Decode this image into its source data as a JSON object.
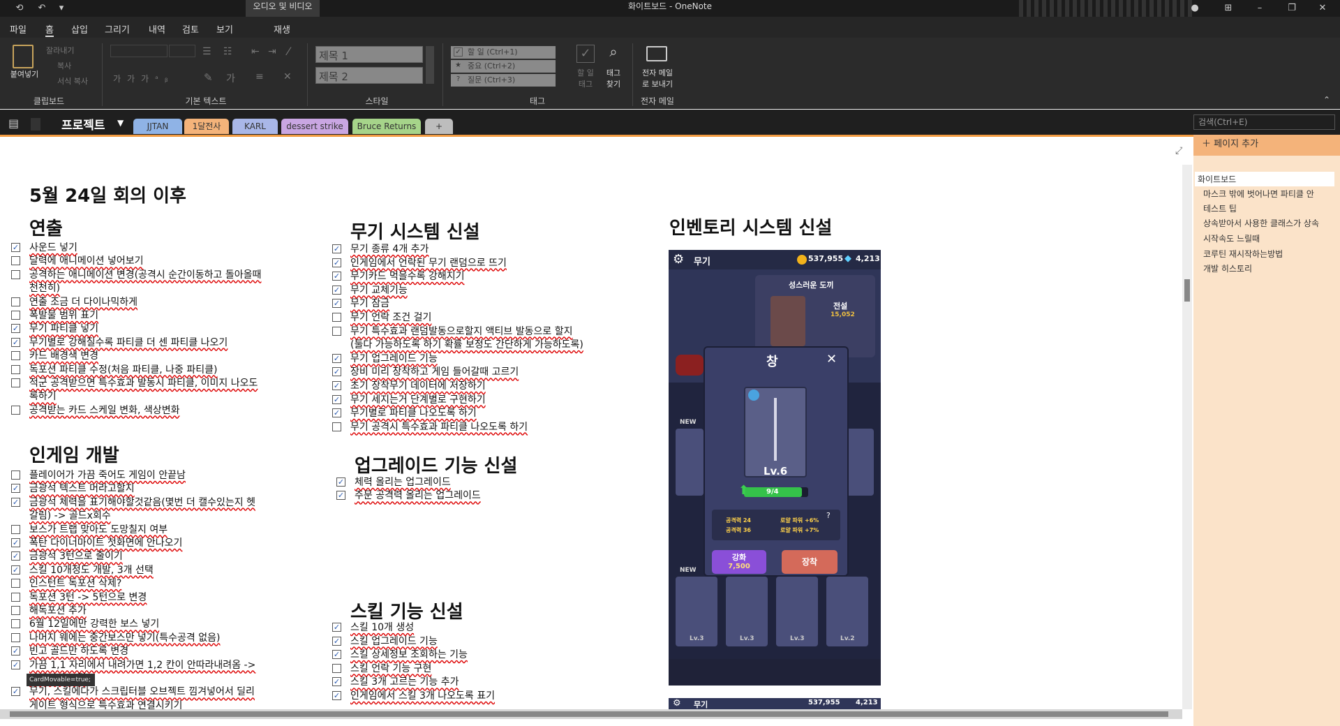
{
  "titlebar": {
    "context_tab": "오디오 및 비디오",
    "window_title": "화이트보드  -  OneNote"
  },
  "menu": [
    "파일",
    "홈",
    "삽입",
    "그리기",
    "내역",
    "검토",
    "보기",
    "재생"
  ],
  "ribbon": {
    "clipboard": {
      "paste": "붙여넣기",
      "cut": "잘라내기",
      "copy": "복사",
      "format": "서식 복사",
      "label": "클립보드"
    },
    "basic_text_label": "기본 텍스트",
    "styles": {
      "h1": "제목 1",
      "h2": "제목 2",
      "label": "스타일"
    },
    "tags": {
      "todo": "할 일 (Ctrl+1)",
      "important": "중요 (Ctrl+2)",
      "question": "질문 (Ctrl+3)",
      "todo_tag": "할 일\n태그",
      "find": "태그\n찾기",
      "label": "태그"
    },
    "email": {
      "send": "전자 메일\n로 보내기",
      "label": "전자 메일"
    }
  },
  "notebook": {
    "name": "프로젝트"
  },
  "sections": [
    {
      "label": "JJTAN",
      "color": "#8fb3e6"
    },
    {
      "label": "1달전사",
      "color": "#f4b37a"
    },
    {
      "label": "KARL",
      "color": "#a9b7e8"
    },
    {
      "label": "dessert strike",
      "color": "#c9a6e2"
    },
    {
      "label": "Bruce Returns",
      "color": "#a6d48a"
    },
    {
      "label": "+",
      "color": "#bdbdbd"
    }
  ],
  "search": {
    "placeholder": "검색(Ctrl+E)"
  },
  "pages": {
    "add": "페이지 추가",
    "items": [
      "화이트보드",
      "마스크 밖에 벗어나면 파티클 안",
      "테스트 팁",
      "상속받아서 사용한 클래스가 상속",
      "시작속도 느릴때",
      "코루틴 재시작하는방법",
      "개발 히스토리"
    ]
  },
  "page_title": "5월 24일 회의 이후",
  "col1": {
    "h_direction": "연출",
    "direction": [
      {
        "t": "사운드 넣기",
        "c": true
      },
      {
        "t": "달력에 애니메이션 넣어보기",
        "c": false
      },
      {
        "t": "공격하는 애니메이션 변경(공격시 순간이동하고 돌아올때",
        "c": false
      },
      {
        "t": "천천히)",
        "c": null
      },
      {
        "t": "연출 조금 더 다이나믹하게",
        "c": false
      },
      {
        "t": "폭발물 범위 표기",
        "c": false
      },
      {
        "t": "무기 파티클 넣기",
        "c": true
      },
      {
        "t": "무기별로 강해질수록 파티클 더 센 파티클 나오기",
        "c": true
      },
      {
        "t": "카드 배경색 변경",
        "c": false
      },
      {
        "t": "독포션 파티클 수정(처음 파티클, 나중 파티클)",
        "c": false
      },
      {
        "t": "적군 공격받으면 특수효과 발동시 파티클, 이미지 나오도",
        "c": false
      },
      {
        "t": "록하기",
        "c": null
      },
      {
        "t": "공격받는 카드 스케일 변화, 색상변화",
        "c": false
      }
    ],
    "h_ingame": "인게임 개발",
    "ingame": [
      {
        "t": "플레이어가 가끔 죽어도 게임이 안끝남",
        "c": false
      },
      {
        "t": "금광석 텍스트 머라고할지",
        "c": true
      },
      {
        "t": "금광석 체력을 표기해야할것같음(몇번 더 캘수있는지 헷",
        "c": true
      },
      {
        "t": "갈림) -> 골드x회수",
        "c": null
      },
      {
        "t": "보스가 트랩 맞아도 도망칠지 여부",
        "c": false
      },
      {
        "t": "폭탄 다이너마이트 첫화면에 안나오기",
        "c": true
      },
      {
        "t": "금광석 3턴으로 줄이기",
        "c": true
      },
      {
        "t": "스킬 10개정도 개발, 3개 선택",
        "c": true
      },
      {
        "t": "인스턴트 독포션 삭제?",
        "c": false
      },
      {
        "t": "독포션 3턴 -> 5턴으로 변경",
        "c": false
      },
      {
        "t": "해독포션 추가",
        "c": false
      },
      {
        "t": "6월 12일에만 강력한 보스 넣기",
        "c": false
      },
      {
        "t": "나머지 웨에는 중간보스만 넣기(특수공격 없음)",
        "c": false
      },
      {
        "t": "빈고 골드만 하도록 변경",
        "c": true
      },
      {
        "t": "가끔 1,1 자리에서 내려가면 1,2 칸이 안따라내려옴 ->",
        "c": true
      },
      {
        "t": "안해줘서 그럼",
        "c": null
      },
      {
        "t": "무기, 스킬에다가 스크립터블 오브젝트 낌겨넣어서 딜리",
        "c": true
      },
      {
        "t": "게이트 형식으로 특수효과 연결시키기",
        "c": null
      }
    ],
    "tooltip": "CardMovable=true;"
  },
  "col2": {
    "h_weapon": "무기 시스템 신설",
    "weapon": [
      {
        "t": "무기 종류 4개 추가",
        "c": true
      },
      {
        "t": "인게임에서 언락된 무기 랜덤으로 뜨기",
        "c": true
      },
      {
        "t": "무기카드 먹을수록 강해지기",
        "c": true
      },
      {
        "t": "무기 교체기능",
        "c": true
      },
      {
        "t": "무기 잠금",
        "c": true
      },
      {
        "t": "무기 언락 조건 걸기",
        "c": false
      },
      {
        "t": "무기 특수효과 랜덤발동으로할지 액티브 발동으로 할지",
        "c": false
      },
      {
        "t": "(둘다 가능하도록 하기 확률 보정도 간단하게 가능하도록)",
        "c": null
      },
      {
        "t": "무기 업그레이드 기능",
        "c": true
      },
      {
        "t": "장비 미리 장착하고 게임 들어갈때 고르기",
        "c": true
      },
      {
        "t": "초기 장착무기 데이터에 저장하기",
        "c": true
      },
      {
        "t": "무기 세지는거 단계별로 구현하기",
        "c": true
      },
      {
        "t": "무기별로 파티클 나오도록 하기",
        "c": true
      },
      {
        "t": "무기 공격시 특수효과 파티클 나오도록 하기",
        "c": false
      }
    ],
    "h_upgrade": "업그레이드 기능 신설",
    "upgrade": [
      {
        "t": "체력 올리는 업그레이드",
        "c": true
      },
      {
        "t": "주문 공격력 올리는 업그레이드",
        "c": true
      }
    ],
    "h_skill": "스킬 기능 신설",
    "skill": [
      {
        "t": "스킬 10개 생성",
        "c": true
      },
      {
        "t": "스킬 업그레이드 기능",
        "c": true
      },
      {
        "t": "스킬 상세정보 조회하는 기능",
        "c": true
      },
      {
        "t": "스킬 언락 기능 구현",
        "c": false
      },
      {
        "t": "스킬 3개 고르는 기능 추가",
        "c": true
      },
      {
        "t": "인게임에서 스킬 3개 나오도록 표기",
        "c": true
      }
    ]
  },
  "col3": {
    "h_inventory": "인벤토리 시스템 신설"
  },
  "game": {
    "header": "무기",
    "coins": "537,955",
    "gems": "4,213",
    "panel": "성스러운 도끼",
    "popup_title": "창",
    "level": "Lv.6",
    "progress": "9/4",
    "progress_fraction": 0.9,
    "upgrade": "강화",
    "upgrade_cost": "7,500",
    "equip": "장착",
    "new": "NEW",
    "stat1": "공격력 24",
    "stat2": "공격력 36",
    "bonus1": "로얄 파워 +6%",
    "bonus2": "로얄 파워 +7%",
    "grade": "전설",
    "grade_val": "15,052",
    "lv_labels": [
      "Lv.3",
      "Lv.3",
      "Lv.3",
      "Lv.2"
    ],
    "header2": "무기",
    "coins2": "537,955",
    "gems2": "4,213"
  }
}
